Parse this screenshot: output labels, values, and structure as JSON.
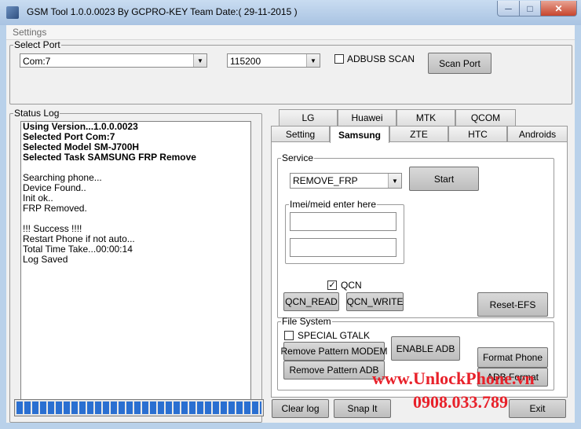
{
  "window": {
    "title": "GSM Tool 1.0.0.0023 By GCPRO-KEY Team  Date:( 29-11-2015 )",
    "min_glyph": "─",
    "max_glyph": "□",
    "close_glyph": "✕"
  },
  "menu": {
    "settings": "Settings"
  },
  "select_port": {
    "legend": "Select Port",
    "port_value": "Com:7",
    "baud_value": "115200",
    "adbusb_label": "ADBUSB SCAN",
    "adbusb_checked": false,
    "scan_button": "Scan Port"
  },
  "status_log": {
    "legend": "Status Log",
    "lines": [
      {
        "text": "Using Version...1.0.0.0023",
        "bold": true
      },
      {
        "text": "Selected Port Com:7",
        "bold": true
      },
      {
        "text": "Selected Model SM-J700H",
        "bold": true
      },
      {
        "text": "Selected Task SAMSUNG FRP Remove",
        "bold": true
      },
      {
        "text": "",
        "bold": false
      },
      {
        "text": "Searching phone...",
        "bold": false
      },
      {
        "text": "Device Found..",
        "bold": false
      },
      {
        "text": "Init ok..",
        "bold": false
      },
      {
        "text": "FRP Removed.",
        "bold": false
      },
      {
        "text": "",
        "bold": false
      },
      {
        "text": "!!! Success !!!!",
        "bold": false
      },
      {
        "text": "Restart Phone if not auto...",
        "bold": false
      },
      {
        "text": "Total Time Take...00:00:14",
        "bold": false
      },
      {
        "text": "Log Saved",
        "bold": false
      }
    ],
    "progress_fraction": 1.0
  },
  "tabs": {
    "row_top": [
      "LG",
      "Huawei",
      "MTK",
      "QCOM"
    ],
    "row_bottom": [
      "Setting",
      "Samsung",
      "ZTE",
      "HTC",
      "Androids"
    ],
    "active": "Samsung"
  },
  "service": {
    "legend": "Service",
    "task_value": "REMOVE_FRP",
    "start_button": "Start",
    "imei_legend": "Imei/meid enter here",
    "imei1": "",
    "imei2": "",
    "qcn_label": "QCN",
    "qcn_checked": true,
    "qcn_read": "QCN_READ",
    "qcn_write": "QCN_WRITE",
    "reset_efs": "Reset-EFS"
  },
  "file_system": {
    "legend": "File System",
    "special_gtalk": "SPECIAL GTALK",
    "special_gtalk_checked": false,
    "remove_pattern_modem": "Remove Pattern MODEM",
    "remove_pattern_adb": "Remove Pattern ADB",
    "enable_adb": "ENABLE ADB",
    "format_phone": "Format Phone",
    "adb_format": "ADB Format"
  },
  "bottom": {
    "clear_log": "Clear log",
    "snap_it": "Snap It",
    "exit": "Exit"
  },
  "watermark": {
    "site": "www.UnlockPhone.vn",
    "phone": "0908.033.789",
    "color": "#e8212a"
  }
}
